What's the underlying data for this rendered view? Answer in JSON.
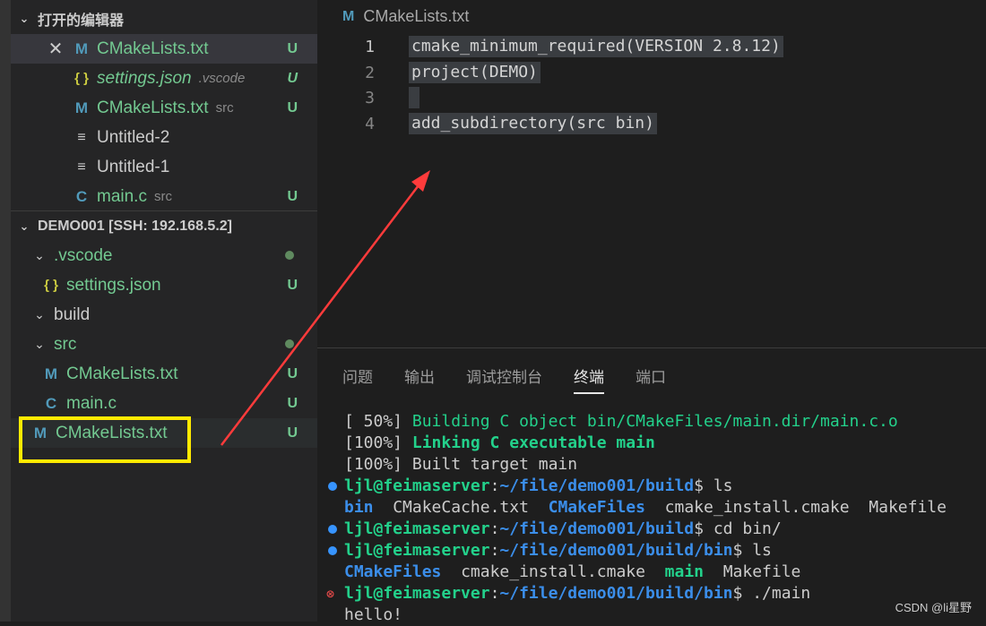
{
  "open_editors": {
    "header": "打开的编辑器",
    "items": [
      {
        "name": "CMakeLists.txt",
        "desc": "",
        "status": "U",
        "icon": "cmake-icon"
      },
      {
        "name": "settings.json",
        "desc": ".vscode",
        "status": "U",
        "icon": "json-icon"
      },
      {
        "name": "CMakeLists.txt",
        "desc": "src",
        "status": "U",
        "icon": "cmake-icon"
      },
      {
        "name": "Untitled-2",
        "desc": "",
        "status": "",
        "icon": "text-lines-icon"
      },
      {
        "name": "Untitled-1",
        "desc": "",
        "status": "",
        "icon": "text-lines-icon"
      },
      {
        "name": "main.c",
        "desc": "src",
        "status": "U",
        "icon": "c-file-icon"
      }
    ]
  },
  "explorer": {
    "header": "DEMO001 [SSH: 192.168.5.2]",
    "items": [
      {
        "name": ".vscode",
        "status": ""
      },
      {
        "name": "settings.json",
        "status": "U"
      },
      {
        "name": "build",
        "status": ""
      },
      {
        "name": "src",
        "status": ""
      },
      {
        "name": "CMakeLists.txt",
        "status": "U"
      },
      {
        "name": "main.c",
        "status": "U"
      },
      {
        "name": "CMakeLists.txt",
        "status": "U"
      }
    ]
  },
  "icons": {
    "cmake": "M",
    "json": "{ }",
    "c": "C",
    "lines": "≡",
    "close": "✕",
    "chevron_down": "⌄",
    "error_circle": "⊗"
  },
  "editor": {
    "breadcrumb": "CMakeLists.txt",
    "lines": [
      {
        "num": "1",
        "text": "cmake_minimum_required(VERSION 2.8.12)"
      },
      {
        "num": "2",
        "text": "project(DEMO)"
      },
      {
        "num": "3",
        "text": " "
      },
      {
        "num": "4",
        "text": "add_subdirectory(src bin)"
      }
    ]
  },
  "panel": {
    "tabs": [
      "问题",
      "输出",
      "调试控制台",
      "终端",
      "端口"
    ],
    "active_tab": "终端",
    "terminal": {
      "l1_prefix": "[ 50%] ",
      "l1_text": "Building C object bin/CMakeFiles/main.dir/main.c.o",
      "l2_prefix": "[100%] ",
      "l2_text": "Linking C executable main",
      "l3": "[100%] Built target main",
      "user": "ljl@feimaserver",
      "path_build": "~/file/demo001/build",
      "path_bin": "~/file/demo001/build/bin",
      "cmd_ls": "ls",
      "cmd_cd": "cd bin/",
      "cmd_run": "./main",
      "ls1": {
        "bin": "bin",
        "cmakecache": "CMakeCache.txt",
        "cmakefiles": "CMakeFiles",
        "install": "cmake_install.cmake",
        "makefile": "Makefile"
      },
      "ls2": {
        "cmakefiles": "CMakeFiles",
        "install": "cmake_install.cmake",
        "main": "main",
        "makefile": "Makefile"
      },
      "output": "hello!"
    }
  },
  "watermark": "CSDN @li星野",
  "colors": {
    "highlight_box": "#ffea00",
    "arrow": "#ff3b3b",
    "untracked_green": "#73c991",
    "terminal_blue": "#3b8eea",
    "terminal_green": "#23d18b"
  }
}
